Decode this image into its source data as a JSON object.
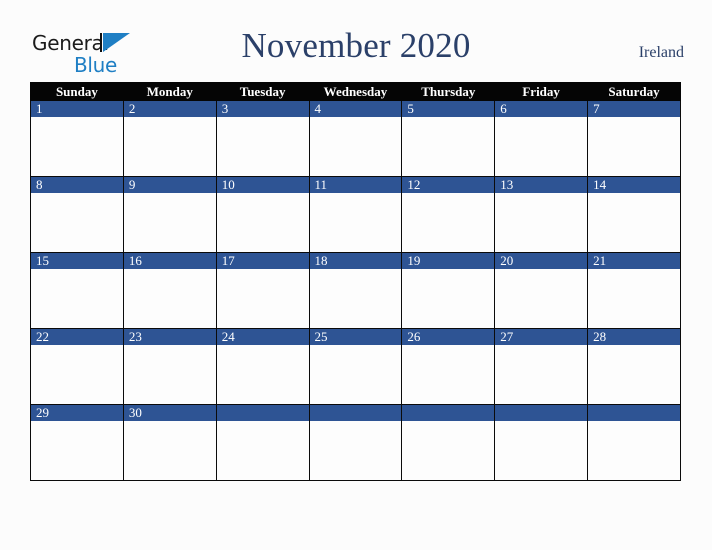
{
  "brand": {
    "word_one": "General",
    "word_two": "Blue",
    "triangle_icon": "blue-triangle-icon",
    "colors": {
      "general_text": "#1b1b1b",
      "blue_text": "#1f7fc4"
    }
  },
  "header": {
    "title": "November 2020",
    "country": "Ireland",
    "title_color": "#2b4069"
  },
  "calendar": {
    "weekday_headers": [
      "Sunday",
      "Monday",
      "Tuesday",
      "Wednesday",
      "Thursday",
      "Friday",
      "Saturday"
    ],
    "header_bg": "#050505",
    "header_text": "#ffffff",
    "daynum_bg": "#2e5494",
    "daynum_text": "#ffffff",
    "cell_bg": "#fdfdfd",
    "border_color": "#0b0b0b",
    "weeks": [
      {
        "days": [
          {
            "num": "1",
            "note": ""
          },
          {
            "num": "2",
            "note": ""
          },
          {
            "num": "3",
            "note": ""
          },
          {
            "num": "4",
            "note": ""
          },
          {
            "num": "5",
            "note": ""
          },
          {
            "num": "6",
            "note": ""
          },
          {
            "num": "7",
            "note": ""
          }
        ]
      },
      {
        "days": [
          {
            "num": "8",
            "note": ""
          },
          {
            "num": "9",
            "note": ""
          },
          {
            "num": "10",
            "note": ""
          },
          {
            "num": "11",
            "note": ""
          },
          {
            "num": "12",
            "note": ""
          },
          {
            "num": "13",
            "note": ""
          },
          {
            "num": "14",
            "note": ""
          }
        ]
      },
      {
        "days": [
          {
            "num": "15",
            "note": ""
          },
          {
            "num": "16",
            "note": ""
          },
          {
            "num": "17",
            "note": ""
          },
          {
            "num": "18",
            "note": ""
          },
          {
            "num": "19",
            "note": ""
          },
          {
            "num": "20",
            "note": ""
          },
          {
            "num": "21",
            "note": ""
          }
        ]
      },
      {
        "days": [
          {
            "num": "22",
            "note": ""
          },
          {
            "num": "23",
            "note": ""
          },
          {
            "num": "24",
            "note": ""
          },
          {
            "num": "25",
            "note": ""
          },
          {
            "num": "26",
            "note": ""
          },
          {
            "num": "27",
            "note": ""
          },
          {
            "num": "28",
            "note": ""
          }
        ]
      },
      {
        "days": [
          {
            "num": "29",
            "note": ""
          },
          {
            "num": "30",
            "note": ""
          },
          {
            "num": "",
            "note": ""
          },
          {
            "num": "",
            "note": ""
          },
          {
            "num": "",
            "note": ""
          },
          {
            "num": "",
            "note": ""
          },
          {
            "num": "",
            "note": ""
          }
        ]
      }
    ]
  }
}
